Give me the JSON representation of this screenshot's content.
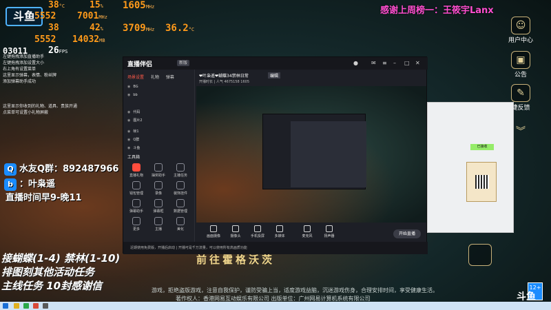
{
  "stream_logo": "斗鱼",
  "hardware": {
    "row1": {
      "a": "38",
      "a_unit": "°C",
      "b": "15",
      "b_unit": "%",
      "c": "1605",
      "c_unit": "MHz"
    },
    "row2": {
      "a": "5552",
      "b": "7001",
      "b_unit": "MHz"
    },
    "row3": {
      "a": "38",
      "b": "42",
      "b_unit": "%",
      "c": "3709",
      "c_unit": "MHz",
      "d": "36.2",
      "d_unit": "°C"
    },
    "row4": {
      "a": "5552",
      "b": "14032",
      "b_unit": "MB"
    },
    "row5": {
      "a": "03011",
      "b": "26",
      "b_unit": "FPS"
    }
  },
  "tips": [
    "左键拖拽添加直播助手",
    "左键拖拽添加设置大小",
    "右上角有设置菜单",
    "这里显示弹幕，表情、粉丝牌",
    "添加弹幕助手成功",
    "这里显示你收到的礼物、道具、贵族开通",
    "点菜单可设置小礼物屏蔽"
  ],
  "thanks_banner": "感谢上周榜一：王筱宇Lanx",
  "side_buttons": [
    {
      "label": "用户中心",
      "icon": "user-center-icon"
    },
    {
      "label": "公告",
      "icon": "notice-icon"
    },
    {
      "label": "捷反馈",
      "icon": "feedback-icon"
    }
  ],
  "qq_group": {
    "label": "水友Q群：",
    "number": "892487966"
  },
  "bilibili": {
    "label": "：叶枭遥"
  },
  "schedule": "直播时间早9-晚11",
  "tasks": [
    "接蝴蝶(1-4) 禁林(1-10)",
    "排图刻其他活动任务",
    "主线任务 10封感谢信"
  ],
  "game_banner": "前往霍格沃茨",
  "disclaimer": {
    "line1": "游戏，拒绝盗版游戏，注意自我保护，谨防受骗上当，适度游戏益脑，沉迷游戏伤身，合理安排时间，享受健康生活。",
    "line2": "著作权人：香港网易互动娱乐有限公司  出版单位：广州网易计算机系统有限公司"
  },
  "app": {
    "logo": "直播伴侣",
    "version": "新版",
    "left_tabs": [
      "场景设置",
      "礼物",
      "弹幕"
    ],
    "scenes": [
      "BG",
      "bb",
      "代码",
      "图片2",
      "帧1",
      "Q群",
      "斗鱼"
    ],
    "tools_title": "工具箱",
    "tools": [
      "直播礼物",
      "抽奖助手",
      "主播任务",
      "钱包管理",
      "录像",
      "装饰挂件",
      "弹幕助手",
      "弹幕框",
      "数据管理",
      "更多",
      "主播",
      "美化"
    ],
    "room_title": "❤叶枭遥❤蝴蝶34禁林日常",
    "room_edit": "编辑",
    "room_sub": "开播时长 | 人气  4675158  1605",
    "bottom_items": [
      "画面摄像",
      "摄像头",
      "手机投屏",
      "多媒体",
      "麦克风",
      "扬声器"
    ],
    "start_button": "开始直播",
    "footer": "近期使用免费版，开播后启动 | 开播可是千万流量，可以使用所有高画质功能"
  },
  "chat": {
    "bubble": "已接收"
  },
  "age_rating": "12+",
  "bottom_logo": "斗鱼"
}
